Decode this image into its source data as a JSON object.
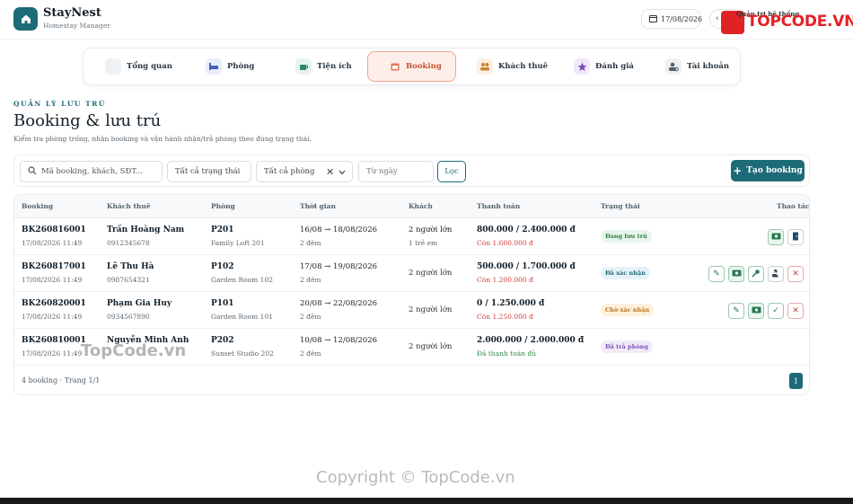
{
  "app": {
    "name": "StayNest",
    "subtitle": "Homestay Manager",
    "date": "17/08/2026",
    "admin_label": "Quản trị hệ thống",
    "brand_watermark": "TOPCODE.VN"
  },
  "nav": {
    "items": [
      {
        "label": "Tổng quan",
        "icon": "home-icon"
      },
      {
        "label": "Phòng",
        "icon": "bed-icon"
      },
      {
        "label": "Tiện ích",
        "icon": "coffee-icon"
      },
      {
        "label": "Booking",
        "icon": "calendar-icon",
        "active": true
      },
      {
        "label": "Khách thuê",
        "icon": "users-icon"
      },
      {
        "label": "Đánh giá",
        "icon": "star-icon"
      },
      {
        "label": "Tài khoản",
        "icon": "user-gear-icon"
      }
    ]
  },
  "page": {
    "kicker": "QUẢN LÝ LƯU TRÚ",
    "title": "Booking & lưu trú",
    "subtitle": "Kiểm tra phòng trống, nhận booking và vận hành nhận/trả phòng theo đúng trạng thái."
  },
  "filters": {
    "search_placeholder": "Mã booking, khách, SĐT...",
    "status_value": "Tất cả trạng thái",
    "room_value": "Tất cả phòng",
    "date_placeholder": "Từ ngày",
    "filter_label": "Lọc",
    "create_label": "Tạo booking"
  },
  "table": {
    "columns": [
      "Booking",
      "Khách thuê",
      "Phòng",
      "Thời gian",
      "Khách",
      "Thanh toán",
      "Trạng thái",
      "Thao tác"
    ],
    "rows": [
      {
        "code": "BK260816001",
        "created": "17/08/2026 11:49",
        "guest": "Trần Hoàng Nam",
        "phone": "0912345678",
        "room": "P201",
        "room_name": "Family Loft 201",
        "time": "16/08 → 18/08/2026",
        "nights": "2 đêm",
        "guests": "2 người lớn",
        "kids": "1 trẻ em",
        "payment": "800.000 / 2.400.000 đ",
        "payment_note": "Còn 1.600.000 đ",
        "status": "Đang lưu trú",
        "status_color": "#e7f5ea",
        "status_text_color": "#2f7d45"
      },
      {
        "code": "BK260817001",
        "created": "17/08/2026 11:49",
        "guest": "Lê Thu Hà",
        "phone": "0987654321",
        "room": "P102",
        "room_name": "Garden Room 102",
        "time": "17/08 → 19/08/2026",
        "nights": "2 đêm",
        "guests": "2 người lớn",
        "kids": "",
        "payment": "500.000 / 1.700.000 đ",
        "payment_note": "Còn 1.200.000 đ",
        "status": "Đã xác nhận",
        "status_color": "#e6f2f7",
        "status_text_color": "#1e6b78"
      },
      {
        "code": "BK260820001",
        "created": "17/08/2026 11:49",
        "guest": "Phạm Gia Huy",
        "phone": "0934567890",
        "room": "P101",
        "room_name": "Garden Room 101",
        "time": "20/08 → 22/08/2026",
        "nights": "2 đêm",
        "guests": "2 người lớn",
        "kids": "",
        "payment": "0 / 1.250.000 đ",
        "payment_note": "Còn 1.250.000 đ",
        "status": "Chờ xác nhận",
        "status_color": "#fdf1dd",
        "status_text_color": "#b5731c"
      },
      {
        "code": "BK260810001",
        "created": "17/08/2026 11:49",
        "guest": "Nguyễn Minh Anh",
        "phone": "",
        "room": "P202",
        "room_name": "Sunset Studio 202",
        "time": "10/08 → 12/08/2026",
        "nights": "2 đêm",
        "guests": "2 người lớn",
        "kids": "",
        "payment": "2.000.000 / 2.000.000 đ",
        "payment_note": "Đã thanh toán đủ",
        "status": "Đã trả phòng",
        "status_color": "#f1eafa",
        "status_text_color": "#7a4fb5"
      }
    ],
    "footer": "4 booking · Trang 1/1",
    "page": "1"
  },
  "watermarks": {
    "a": "TopCode.vn",
    "b": "Copyright © TopCode.vn"
  }
}
